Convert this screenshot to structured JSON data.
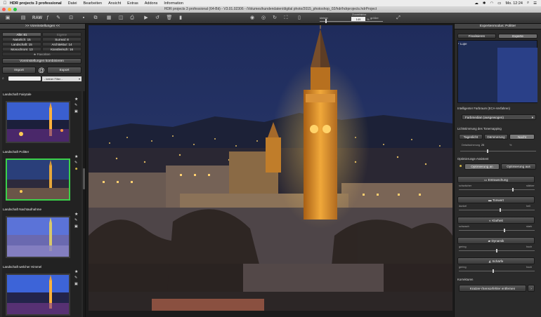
{
  "menubar": {
    "apple": "",
    "items": [
      "HDR projects 3 professional",
      "Datei",
      "Bearbeiten",
      "Ansicht",
      "Extras",
      "Addons",
      "Information"
    ],
    "clock": "Mo. 12:24"
  },
  "window": {
    "title": "HDR projects 3 professional (64-Bit) - V3.01.02306 - /Volumes/kundendaten/digital photo/2015_photoshop_02/hdr/hdrprojects.hdrProject"
  },
  "toolbar": {
    "raw_label": "RAW",
    "zoom_label": "Zoomfaktor",
    "zoom_value": "149",
    "zoom_unit": "%",
    "zoom_small": "kleiner",
    "zoom_large": "größer"
  },
  "left": {
    "header": ">> Voreinstellungen <<",
    "categories": [
      [
        "Alle: 81",
        "Eigene"
      ],
      [
        "Natürlich: 15",
        "Surreal: 8"
      ],
      [
        "Landschaft: 15",
        "Architektur: 14"
      ],
      [
        "Monochrom: 13",
        "Künstlerisch: 16"
      ]
    ],
    "favorites": "Favoriten",
    "combine_button": "Voreinstellungen kombinieren",
    "import_button": "Import",
    "at_symbol": "@",
    "export_button": "Export",
    "filter_value": "- keiner Filter -",
    "presets": [
      "Landschaft Fairytale",
      "Landschaft Politter",
      "Landschaft Nachtaufnahme",
      "Landschaft welcher Himmel"
    ],
    "selected_index": 1
  },
  "right": {
    "header": "Expertenmodus: Politter",
    "tabs": [
      "Finalisieren",
      "Experte"
    ],
    "active_tab": 1,
    "loupe": "Lupe",
    "ee_section": "Intelligenter Farbraum (ECA-Verfahren)",
    "ee_value": "Farbmedian (ausgewogen)",
    "tone_section": "Lichtstimmung des Tonemapping",
    "tone_options": [
      "Tageslicht",
      "Dämmerung",
      "Nacht"
    ],
    "tone_active": 2,
    "detail_label": "Detailsicherung",
    "detail_value": "25",
    "detail_unit": "%",
    "opt_section": "Optimierungs-Assistent",
    "opt_on": "Optimierung an",
    "opt_off": "Optimierung aus",
    "sliders": [
      {
        "name": "Entrauschung",
        "left": "schwächer",
        "right": "stärker",
        "value": 0.72
      },
      {
        "name": "Tonwert",
        "left": "dunkel",
        "right": "hell",
        "value": 0.55
      },
      {
        "name": "Klarheit",
        "left": "schwach",
        "right": "stark",
        "value": 0.6
      },
      {
        "name": "Dynamik",
        "left": "gering",
        "right": "hoch",
        "value": 0.5
      },
      {
        "name": "Schärfe",
        "left": "gering",
        "right": "hoch",
        "value": 0.45
      }
    ],
    "corrections_section": "Korrekturen",
    "sensor_button": "Kratzer-/Sensorfehler entfernen"
  }
}
